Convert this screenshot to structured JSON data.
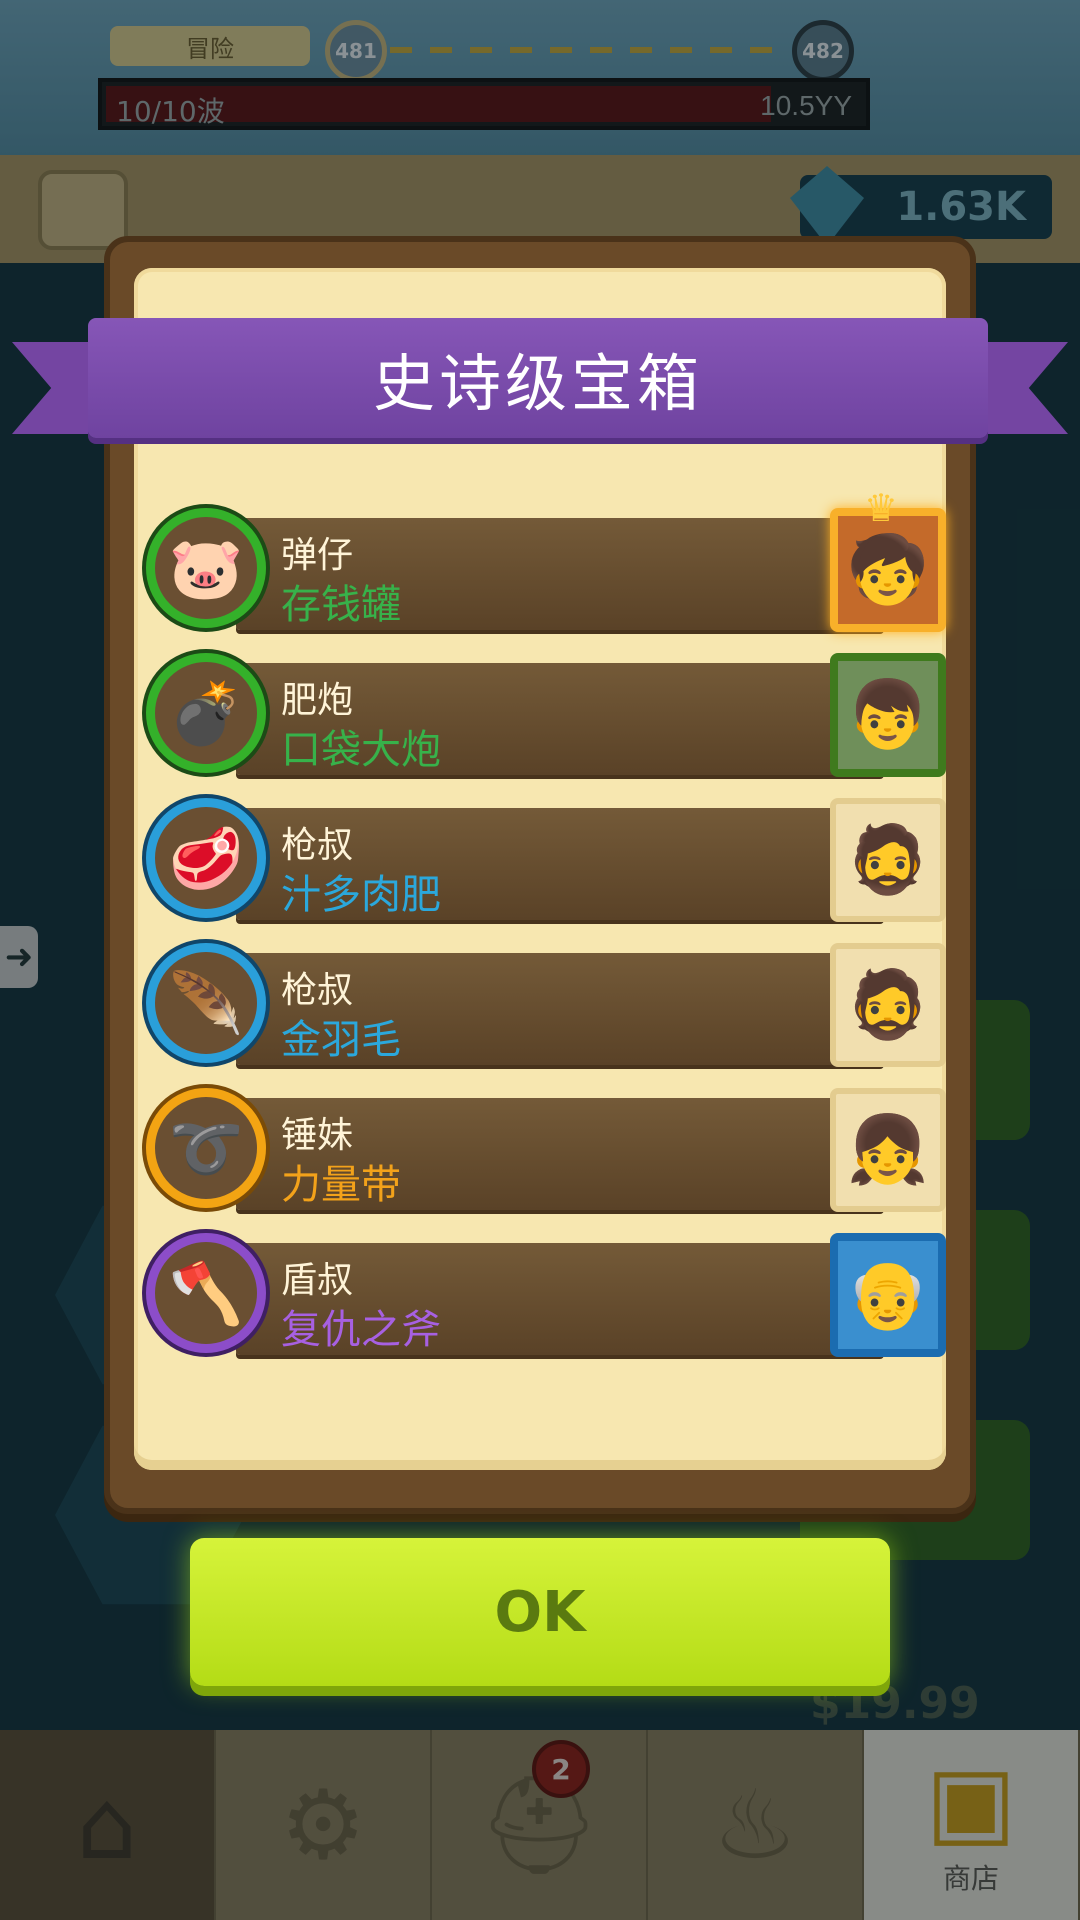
{
  "hud": {
    "stage_label": "冒险",
    "current_level": "481",
    "next_level": "482",
    "wave_text": "10/10波",
    "wave_progress": 0.88,
    "power_text": "10.5YY",
    "gems": "1.63K"
  },
  "background": {
    "price": "$19.99"
  },
  "modal": {
    "title": "史诗级宝箱",
    "rewards": [
      {
        "hero": "弹仔",
        "item": "存钱罐",
        "rarity": "green",
        "item_icon": "piggy-bank-icon",
        "portrait": "gold"
      },
      {
        "hero": "肥炮",
        "item": "口袋大炮",
        "rarity": "green",
        "item_icon": "cannon-icon",
        "portrait": "green"
      },
      {
        "hero": "枪叔",
        "item": "汁多肉肥",
        "rarity": "blue",
        "item_icon": "meat-icon",
        "portrait": "paper"
      },
      {
        "hero": "枪叔",
        "item": "金羽毛",
        "rarity": "blue",
        "item_icon": "feather-icon",
        "portrait": "paper"
      },
      {
        "hero": "锤妹",
        "item": "力量带",
        "rarity": "orange",
        "item_icon": "belt-icon",
        "portrait": "paper"
      },
      {
        "hero": "盾叔",
        "item": "复仇之斧",
        "rarity": "purple",
        "item_icon": "axe-icon",
        "portrait": "blue"
      }
    ],
    "ok_label": "OK"
  },
  "nav": {
    "badge_count": "2",
    "shop_label": "商店"
  },
  "colors": {
    "ribbon": "#7445a2",
    "ok_button": "#c8e82a",
    "rarity_green": "#37b24a",
    "rarity_blue": "#2ba8dc",
    "rarity_orange": "#f3a21a",
    "rarity_purple": "#a760e2"
  }
}
